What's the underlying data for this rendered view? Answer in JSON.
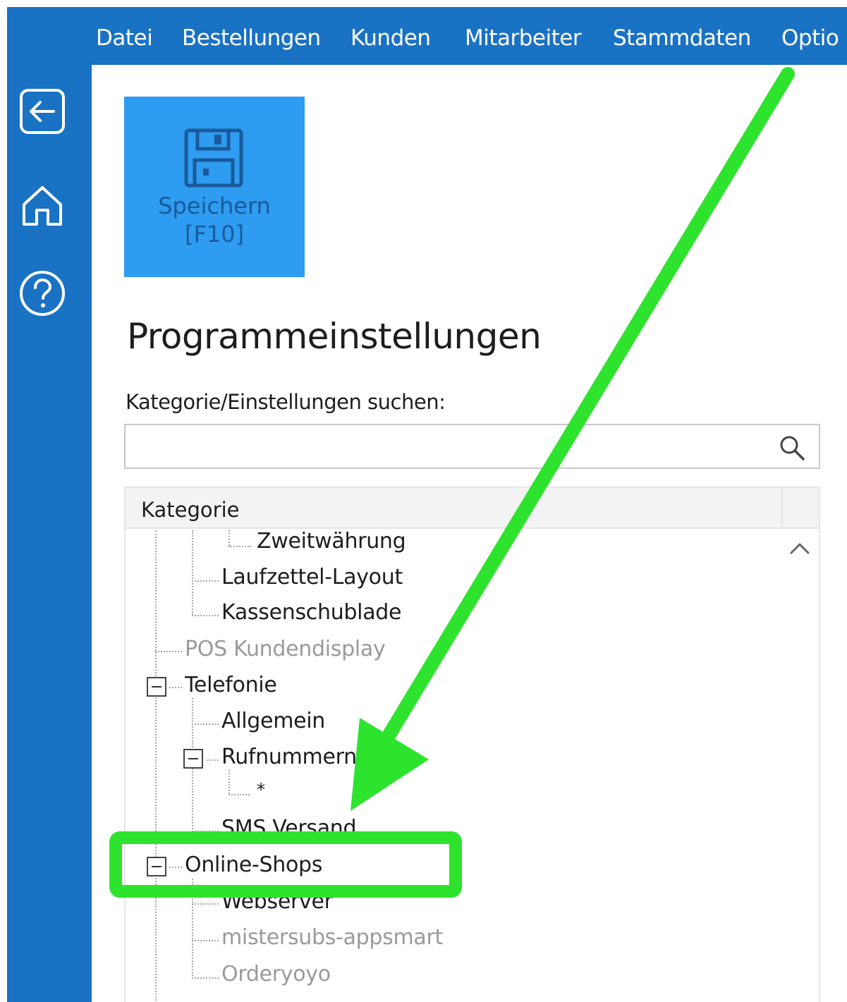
{
  "menubar": {
    "items": [
      "Datei",
      "Bestellungen",
      "Kunden",
      "Mitarbeiter",
      "Stammdaten",
      "Optio"
    ]
  },
  "sidebar": {
    "icons": [
      "back-arrow-icon",
      "home-icon",
      "help-icon"
    ]
  },
  "toolbar": {
    "save_label_line1": "Speichern",
    "save_label_line2": "[F10]"
  },
  "page": {
    "title": "Programmeinstellungen",
    "search_label": "Kategorie/Einstellungen suchen:",
    "search_value": "",
    "search_placeholder": ""
  },
  "tree": {
    "header": "Kategorie",
    "nodes": [
      {
        "label": "Zweitwährung"
      },
      {
        "label": "Laufzettel-Layout"
      },
      {
        "label": "Kassenschublade"
      },
      {
        "label": "POS Kundendisplay"
      },
      {
        "label": "Telefonie"
      },
      {
        "label": "Allgemein"
      },
      {
        "label": "Rufnummern"
      },
      {
        "label": "*"
      },
      {
        "label": "SMS Versand"
      },
      {
        "label": "Online-Shops"
      },
      {
        "label": "Webserver"
      },
      {
        "label": "mistersubs-appsmart"
      },
      {
        "label": "Orderyoyo"
      }
    ]
  },
  "colors": {
    "accent_blue": "#1a72c4",
    "save_tile": "#2e9cf0",
    "highlight_green": "#2ee32e"
  }
}
